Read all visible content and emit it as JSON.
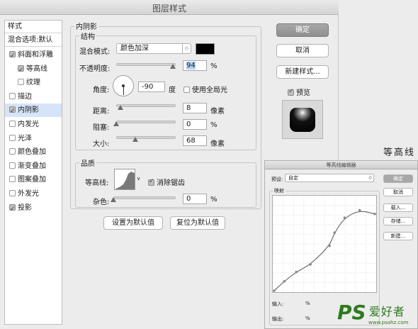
{
  "window": {
    "title": "图层样式"
  },
  "sidebar": {
    "header": "样式",
    "blend_options": "混合选项:默认",
    "items": [
      {
        "label": "斜面和浮雕",
        "checked": true,
        "indent": false,
        "selected": false
      },
      {
        "label": "等高线",
        "checked": true,
        "indent": true,
        "selected": false
      },
      {
        "label": "纹理",
        "checked": false,
        "indent": true,
        "selected": false
      },
      {
        "label": "描边",
        "checked": false,
        "indent": false,
        "selected": false
      },
      {
        "label": "内阴影",
        "checked": true,
        "indent": false,
        "selected": true
      },
      {
        "label": "内发光",
        "checked": false,
        "indent": false,
        "selected": false
      },
      {
        "label": "光泽",
        "checked": false,
        "indent": false,
        "selected": false
      },
      {
        "label": "颜色叠加",
        "checked": false,
        "indent": false,
        "selected": false
      },
      {
        "label": "渐变叠加",
        "checked": false,
        "indent": false,
        "selected": false
      },
      {
        "label": "图案叠加",
        "checked": false,
        "indent": false,
        "selected": false
      },
      {
        "label": "外发光",
        "checked": false,
        "indent": false,
        "selected": false
      },
      {
        "label": "投影",
        "checked": true,
        "indent": false,
        "selected": false
      }
    ]
  },
  "inner_shadow": {
    "title": "内阴影",
    "structure": {
      "title": "结构",
      "blend_mode_label": "混合模式:",
      "blend_mode_value": "颜色加深",
      "swatch_color": "#000000",
      "opacity_label": "不透明度:",
      "opacity_value": "94",
      "opacity_unit": "%",
      "angle_label": "角度:",
      "angle_value": "-90",
      "angle_unit": "度",
      "global_light_label": "使用全局光",
      "distance_label": "距离:",
      "distance_value": "8",
      "distance_unit": "像素",
      "choke_label": "阻塞:",
      "choke_value": "0",
      "choke_unit": "%",
      "size_label": "大小:",
      "size_value": "68",
      "size_unit": "像素"
    },
    "quality": {
      "title": "品质",
      "contour_label": "等高线:",
      "antialias_label": "消除锯齿",
      "noise_label": "杂色:",
      "noise_value": "0",
      "noise_unit": "%"
    },
    "set_default": "设置为默认值",
    "reset_default": "复位为默认值"
  },
  "buttons": {
    "ok": "确定",
    "cancel": "取消",
    "new_style": "新建样式...",
    "preview": "预览"
  },
  "contour_editor": {
    "title": "等高线编辑器",
    "preset_label": "预设:",
    "preset_value": "自定",
    "mapping_label": "映射",
    "input_label": "输入:",
    "input_unit": "%",
    "output_label": "输出:",
    "output_unit": "%",
    "ok": "确定",
    "cancel": "取消",
    "load": "载入...",
    "save": "存储...",
    "new": "新建...",
    "curve_points": [
      [
        0,
        0
      ],
      [
        0.1,
        0.1
      ],
      [
        0.22,
        0.2
      ],
      [
        0.36,
        0.28
      ],
      [
        0.55,
        0.48
      ],
      [
        0.6,
        0.62
      ],
      [
        0.7,
        0.78
      ],
      [
        0.85,
        0.86
      ],
      [
        1.0,
        0.82
      ]
    ]
  },
  "overlay_text": "等高线",
  "watermark": {
    "ps": "PS",
    "cn": "爱好者",
    "url": "www.psahz.com"
  }
}
